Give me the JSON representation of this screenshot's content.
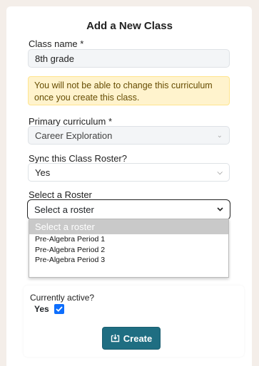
{
  "form": {
    "title": "Add a New Class",
    "class_name": {
      "label": "Class name *",
      "value": "8th grade"
    },
    "curriculum_warning": "You will not be able to change this curriculum once you create this class.",
    "primary_curriculum": {
      "label": "Primary curriculum *",
      "value": "Career Exploration"
    },
    "sync_roster": {
      "label": "Sync this Class Roster?",
      "value": "Yes"
    },
    "roster": {
      "label": "Select a Roster",
      "value": "Select a roster",
      "options": [
        "Select a roster",
        "Pre-Algebra Period 1",
        "Pre-Algebra Period 2",
        "Pre-Algebra Period 3"
      ]
    },
    "currently_active": {
      "label": "Currently active?",
      "value_label": "Yes",
      "checked": true
    },
    "create_button": "Create",
    "accent_color": "#1f6e82"
  }
}
